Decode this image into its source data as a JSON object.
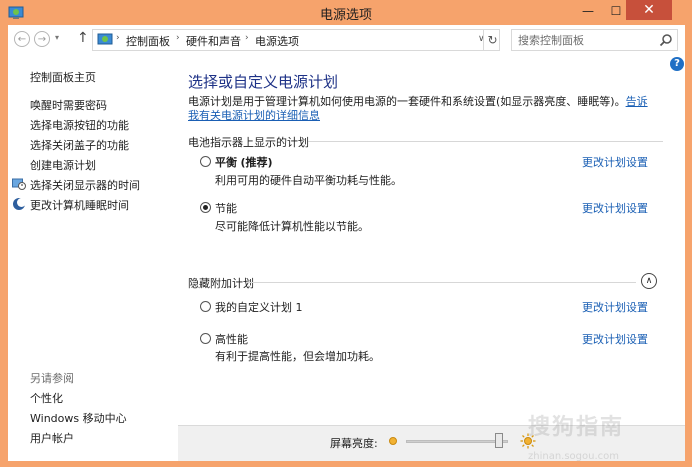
{
  "window": {
    "title": "电源选项",
    "minimize_glyph": "—",
    "maximize_glyph": "☐",
    "close_glyph": "✕"
  },
  "nav": {
    "back_glyph": "←",
    "forward_glyph": "→",
    "dropdown_glyph": "▾",
    "up_glyph": "↑",
    "breadcrumb": [
      "控制面板",
      "硬件和声音",
      "电源选项"
    ],
    "crumb_separator": "›",
    "address_dropdown_glyph": "∨",
    "refresh_glyph": "↻",
    "search_placeholder": "搜索控制面板"
  },
  "icons": {
    "app": "control-panel-icon",
    "address": "control-panel-icon",
    "search": "search-icon",
    "help": "help-icon",
    "display_timer": "monitor-clock-icon",
    "sleep_timer": "moon-icon",
    "dim": "sun-dim-icon",
    "bright": "sun-bright-icon"
  },
  "help_glyph": "?",
  "sidebar": {
    "home_link": "控制面板主页",
    "links": [
      "唤醒时需要密码",
      "选择电源按钮的功能",
      "选择关闭盖子的功能",
      "创建电源计划",
      "选择关闭显示器的时间",
      "更改计算机睡眠时间"
    ],
    "see_also_title": "另请参阅",
    "see_also": [
      "个性化",
      "Windows 移动中心",
      "用户帐户"
    ]
  },
  "main": {
    "title": "选择或自定义电源计划",
    "description": "电源计划是用于管理计算机如何使用电源的一套硬件和系统设置(如显示器亮度、睡眠等)。",
    "more_info_link": "告诉我有关电源计划的详细信息",
    "battery_group_label": "电池指示器上显示的计划",
    "hidden_group_label": "隐藏附加计划",
    "collapse_glyph": "∧",
    "change_link_label": "更改计划设置",
    "plans": [
      {
        "name": "平衡",
        "tag": "(推荐)",
        "desc": "利用可用的硬件自动平衡功耗与性能。",
        "selected": false
      },
      {
        "name": "节能",
        "tag": "",
        "desc": "尽可能降低计算机性能以节能。",
        "selected": true
      },
      {
        "name": "我的自定义计划 1",
        "tag": "",
        "desc": "",
        "selected": false
      },
      {
        "name": "高性能",
        "tag": "",
        "desc": "有利于提高性能，但会增加功耗。",
        "selected": false
      }
    ]
  },
  "brightness": {
    "label": "屏幕亮度:",
    "level": 0.95
  },
  "watermark": {
    "text": "搜狗指南",
    "sub": "zhinan.sogou.com"
  },
  "colors": {
    "titlebar": "#f6a36c",
    "close_button": "#c7503b",
    "link": "#1a5fb4",
    "heading": "#1e3287"
  }
}
